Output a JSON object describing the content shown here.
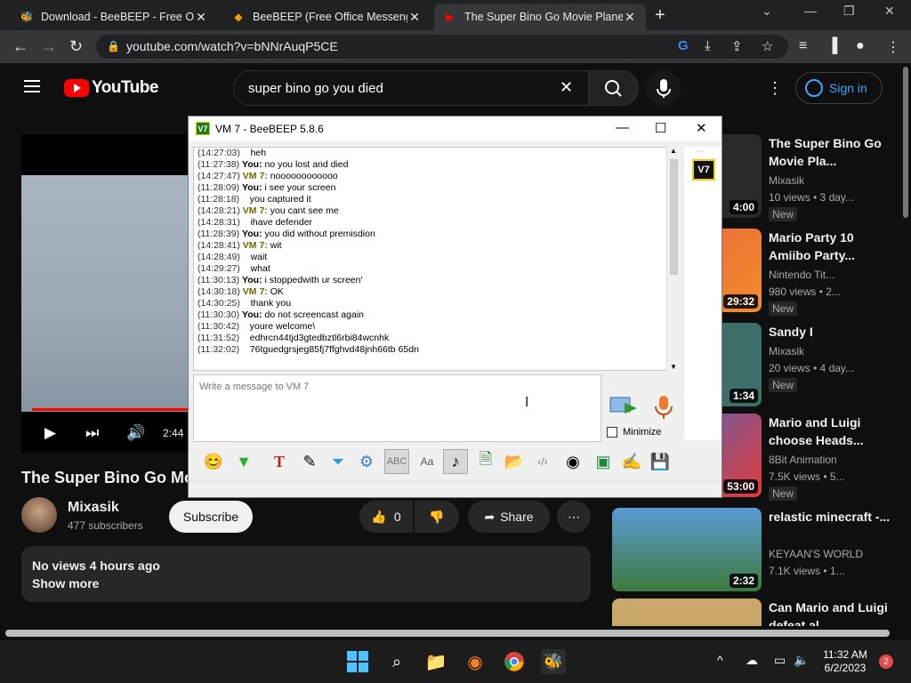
{
  "browser": {
    "tabs": [
      {
        "title": "Download - BeeBEEP - Free Offic",
        "active": false
      },
      {
        "title": "BeeBEEP (Free Office Messenger)",
        "active": false
      },
      {
        "title": "The Super Bino Go Movie Plane C",
        "active": true
      }
    ],
    "url": "youtube.com/watch?v=bNNrAuqP5CE"
  },
  "youtube": {
    "logo_text": "YouTube",
    "search_query": "super bino go you died",
    "sign_in_label": "Sign in",
    "video_title": "The Super Bino Go Mo",
    "player_time": "2:44",
    "channel_name": "Mixasik",
    "subscribers": "477 subscribers",
    "subscribe_label": "Subscribe",
    "likes": "0",
    "share_label": "Share",
    "description_meta": "No views  4 hours ago",
    "show_more": "Show more",
    "recommendations": [
      {
        "title": "The Super Bino Go Movie Pla...",
        "channel": "Mixasik",
        "meta": "10 views  • 3 day...",
        "badge": "New",
        "duration": "4:00"
      },
      {
        "title": "Mario Party 10 Amiibo Party...",
        "channel": "Nintendo Tit...",
        "meta": "980 views  • 2...",
        "badge": "New",
        "duration": "29:32"
      },
      {
        "title": "Sandy I",
        "channel": "Mixasik",
        "meta": "20 views  • 4 day...",
        "badge": "New",
        "duration": "1:34"
      },
      {
        "title": "Mario and Luigi choose Heads...",
        "channel": "8Bit Animation",
        "meta": "7.5K views  • 5...",
        "badge": "New",
        "duration": "53:00"
      },
      {
        "title": "relastic minecraft -...",
        "channel": "KEYAAN'S WORLD",
        "meta": "7.1K views  • 1...",
        "badge": "",
        "duration": "2:32"
      },
      {
        "title": "Can Mario and Luigi defeat al...",
        "channel": "",
        "meta": "",
        "badge": "",
        "duration": ""
      }
    ]
  },
  "beebeep": {
    "window_title": "VM 7 - BeeBEEP 5.8.6",
    "logo_text": "V7",
    "messages": [
      {
        "time": "(14:27:03)",
        "sender": "",
        "text": "heh"
      },
      {
        "time": "(11:27:38)",
        "sender": "You:",
        "text": "no you lost and died"
      },
      {
        "time": "(14:27:47)",
        "sender": "VM 7:",
        "text": "noooooooooooo"
      },
      {
        "time": "(11:28:09)",
        "sender": "You:",
        "text": "i see your screen"
      },
      {
        "time": "(11:28:18)",
        "sender": "",
        "text": "you captured it"
      },
      {
        "time": "(14:28:21)",
        "sender": "VM 7:",
        "text": "you cant see me"
      },
      {
        "time": "(14:28:31)",
        "sender": "",
        "text": "ihave defender"
      },
      {
        "time": "(11:28:39)",
        "sender": "You:",
        "text": "you did without premisdion"
      },
      {
        "time": "(14:28:41)",
        "sender": "VM 7:",
        "text": "wit"
      },
      {
        "time": "(14:28:49)",
        "sender": "",
        "text": "wait"
      },
      {
        "time": "(14:29:27)",
        "sender": "",
        "text": "what"
      },
      {
        "time": "(11:30:13)",
        "sender": "You:",
        "text": "i stoppedwith ur screen'"
      },
      {
        "time": "(14:30:18)",
        "sender": "VM 7:",
        "text": "OK"
      },
      {
        "time": "(14:30:25)",
        "sender": "",
        "text": "thank you"
      },
      {
        "time": "(11:30:30)",
        "sender": "You:",
        "text": "do not screencast again"
      },
      {
        "time": "(11:30:42)",
        "sender": "",
        "text": "youre welcome\\"
      },
      {
        "time": "(11:31:52)",
        "sender": "",
        "text": "edhrcn44tjd3gtedbztl6rbi84wcnhk"
      },
      {
        "time": "(11:32:02)",
        "sender": "",
        "text": "76tguedgrsjeg85fj7ffghvd48jnh66tb   65dn"
      }
    ],
    "input_placeholder": "Write a message to VM 7",
    "minimize_label": "Minimize"
  },
  "taskbar": {
    "time": "11:32 AM",
    "date": "6/2/2023",
    "notification_count": "2"
  },
  "colors": {
    "youtube_red": "#ff0000",
    "link_blue": "#3ea6ff",
    "beebeep_green": "#1a7d1a"
  }
}
